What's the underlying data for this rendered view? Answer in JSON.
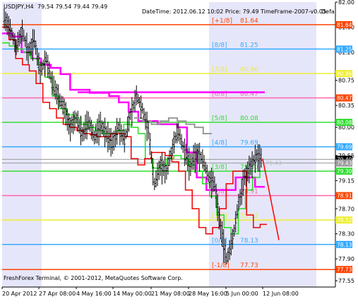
{
  "header": {
    "symbol": "USDJPY,H4",
    "ohlc": "79.54 79.54 79.44 79.49",
    "info": "DateTime: 2012.06.12 10:02   Price: 79.49   TimeFrame-2007-v0.05",
    "side_label": "Defa"
  },
  "footer": {
    "copyright": "FreshForex Terminal, © 2001-2012, MetaQuotes Software Corp."
  },
  "colors": {
    "background": "#ffffff",
    "shade": "#e6e6fa",
    "candles": "#000000",
    "red_ma": "#ee0000",
    "green_ma": "#22dd22",
    "gray_ma": "#999999",
    "magenta_ma": "#ff00ff",
    "projection": "#ff0000"
  },
  "chart_data": {
    "type": "candlestick",
    "symbol": "USDJPY,H4",
    "ylim": [
      77.45,
      82.0
    ],
    "price_ticks": [
      "82.00",
      "81.60",
      "81.20",
      "80.75",
      "80.35",
      "80.00",
      "79.55",
      "79.15",
      "78.70",
      "78.30",
      "77.90",
      "77.55"
    ],
    "time_ticks": [
      "20 Apr 2012",
      "27 Apr 08:00",
      "4 May 16:00",
      "14 May 00:00",
      "21 May 08:00",
      "28 May 16:00",
      "5 Jun 00:00",
      "12 Jun 08:00"
    ],
    "murrey_levels": [
      {
        "label": "[+1/8]",
        "price": 81.64,
        "value": "81.64",
        "color": "#ff4400"
      },
      {
        "label": "[8/8]",
        "price": 81.25,
        "value": "81.25",
        "color": "#33aaff"
      },
      {
        "label": "[7/8]",
        "price": 80.86,
        "value": "80.86",
        "color": "#eeee33"
      },
      {
        "label": "[6/8]",
        "price": 80.47,
        "value": "80.47",
        "color": "#ff66aa"
      },
      {
        "label": "[5/8]",
        "price": 80.08,
        "value": "80.08",
        "color": "#33dd33"
      },
      {
        "label": "[4/8]",
        "price": 79.69,
        "value": "79.69",
        "color": "#33aaff"
      },
      {
        "label": "[3/8]",
        "price": 79.3,
        "value": "79.30",
        "color": "#33dd33"
      },
      {
        "label": "[2/8]",
        "price": 78.91,
        "value": "78.91",
        "color": "#ff66aa"
      },
      {
        "label": "[1/8]",
        "price": 78.52,
        "value": "78.52",
        "color": "#eeee33"
      },
      {
        "label": "[0/8]",
        "price": 78.13,
        "value": "78.13",
        "color": "#33aaff"
      },
      {
        "label": "[-1/8]",
        "price": 77.73,
        "value": "77.73",
        "color": "#ff4400"
      }
    ],
    "extra_line_prices": [
      79.49,
      79.43
    ],
    "overlay_text": "79.43",
    "magenta_level": {
      "price": 80.56
    },
    "price_labels": [
      {
        "text": "81.64",
        "price": 81.64,
        "bg": "#ff4400",
        "fg": "#ffffff"
      },
      {
        "text": "81.25",
        "price": 81.25,
        "bg": "#33aaff",
        "fg": "#ffffff"
      },
      {
        "text": "80.86",
        "price": 80.86,
        "bg": "#eeee33",
        "fg": "#ffffff"
      },
      {
        "text": "80.47",
        "price": 80.47,
        "bg": "#ff4400",
        "fg": "#ffffff"
      },
      {
        "text": "80.08",
        "price": 80.08,
        "bg": "#33dd33",
        "fg": "#ffffff"
      },
      {
        "text": "79.69",
        "price": 79.69,
        "bg": "#33aaff",
        "fg": "#ffffff"
      },
      {
        "text": "79.49",
        "price": 79.49,
        "bg": "#000000",
        "fg": "#ffffff"
      },
      {
        "text": "79.43",
        "price": 79.43,
        "bg": "#999999",
        "fg": "#ffffff"
      },
      {
        "text": "79.30",
        "price": 79.3,
        "bg": "#33dd33",
        "fg": "#ffffff"
      },
      {
        "text": "78.91",
        "price": 78.91,
        "bg": "#ff4400",
        "fg": "#ffffff"
      },
      {
        "text": "78.52",
        "price": 78.52,
        "bg": "#eeee33",
        "fg": "#ffffff"
      },
      {
        "text": "78.13",
        "price": 78.13,
        "bg": "#33aaff",
        "fg": "#ffffff"
      },
      {
        "text": "77.73",
        "price": 77.73,
        "bg": "#ff4400",
        "fg": "#ffffff"
      }
    ],
    "close_path": [
      81.75,
      81.55,
      81.3,
      81.55,
      81.2,
      81.4,
      80.9,
      81.1,
      80.7,
      80.5,
      80.3,
      80.0,
      80.15,
      79.9,
      80.1,
      79.85,
      80.05,
      79.9,
      79.75,
      80.0,
      79.8,
      80.2,
      80.5,
      80.3,
      79.95,
      79.1,
      79.4,
      79.3,
      79.7,
      79.95,
      79.6,
      79.4,
      79.6,
      79.5,
      79.2,
      79.1,
      78.4,
      77.9,
      78.2,
      78.8,
      79.2,
      79.4,
      79.55,
      79.49
    ],
    "red_ma": [
      81.6,
      81.4,
      81.1,
      81.0,
      80.9,
      80.7,
      80.4,
      80.3,
      80.15,
      80.05,
      80.0,
      79.95,
      79.9,
      79.88,
      79.85,
      79.85,
      79.9,
      79.9,
      79.85,
      79.5,
      79.4,
      79.5,
      79.6,
      79.6,
      79.55,
      79.45,
      79.3,
      79.0,
      78.7,
      78.4,
      78.3,
      78.4,
      78.7,
      79.1,
      79.3,
      79.3,
      78.6,
      78.4,
      78.45
    ],
    "green_ma": [
      81.35,
      81.3,
      81.25,
      81.2,
      81.1,
      81.0,
      80.8,
      80.5,
      80.3,
      80.2,
      80.15,
      80.05,
      80.0,
      79.95,
      79.9,
      79.9,
      79.95,
      80.05,
      80.0,
      79.9,
      79.5,
      79.35,
      79.4,
      79.5,
      79.55,
      79.5,
      79.4,
      79.3,
      79.1,
      78.9,
      78.6,
      78.4,
      78.3,
      78.7,
      79.0,
      79.2,
      79.3
    ],
    "gray_ma": [
      80.15,
      80.1,
      80.05,
      80.1,
      80.15,
      80.1,
      80.05,
      80.0,
      79.9
    ],
    "magenta_ma": [
      81.5,
      81.45,
      81.2,
      81.1,
      81.0,
      80.95,
      80.85,
      80.6,
      80.6,
      80.55,
      80.55,
      80.5,
      80.4,
      80.25,
      80.1,
      80.1,
      80.05,
      80.05,
      80.0,
      79.6,
      79.2,
      79.0,
      79.0,
      79.0,
      79.2,
      79.2,
      79.05
    ],
    "projection": [
      79.5,
      78.2
    ]
  }
}
